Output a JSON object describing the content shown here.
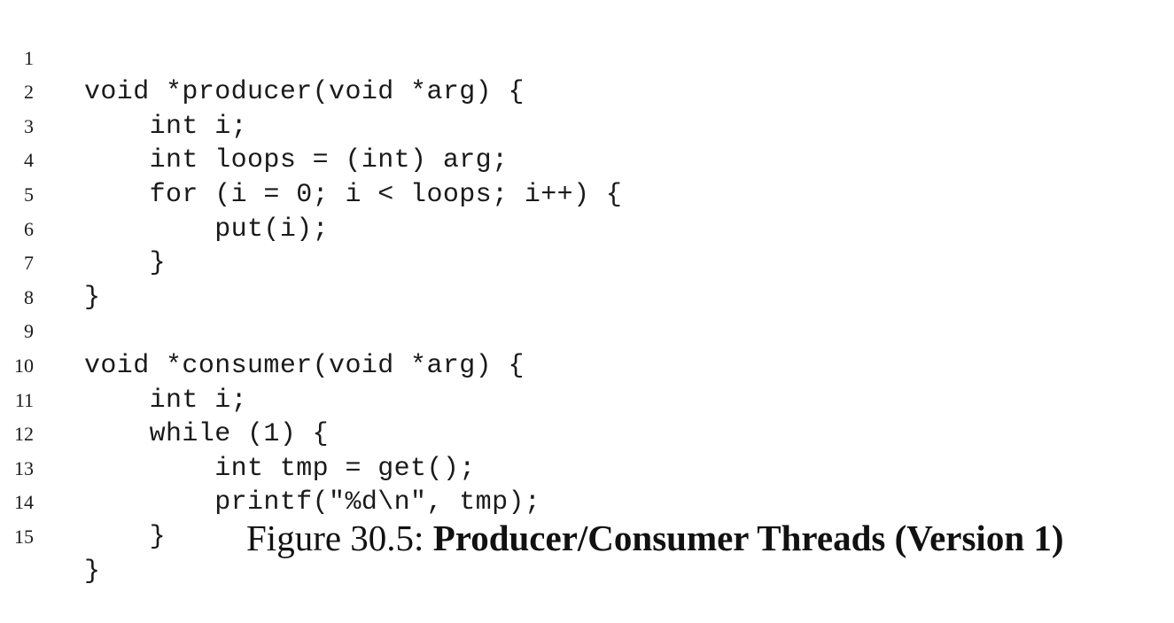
{
  "code": {
    "lines": [
      {
        "number": "1",
        "text": "void *producer(void *arg) {"
      },
      {
        "number": "2",
        "text": "    int i;"
      },
      {
        "number": "3",
        "text": "    int loops = (int) arg;"
      },
      {
        "number": "4",
        "text": "    for (i = 0; i < loops; i++) {"
      },
      {
        "number": "5",
        "text": "        put(i);"
      },
      {
        "number": "6",
        "text": "    }"
      },
      {
        "number": "7",
        "text": "}"
      },
      {
        "number": "8",
        "text": ""
      },
      {
        "number": "9",
        "text": "void *consumer(void *arg) {"
      },
      {
        "number": "10",
        "text": "    int i;"
      },
      {
        "number": "11",
        "text": "    while (1) {"
      },
      {
        "number": "12",
        "text": "        int tmp = get();"
      },
      {
        "number": "13",
        "text": "        printf(\"%d\\n\", tmp);"
      },
      {
        "number": "14",
        "text": "    }"
      },
      {
        "number": "15",
        "text": "}"
      }
    ]
  },
  "caption": {
    "label": "Figure 30.5: ",
    "title": "Producer/Consumer Threads (Version 1)"
  }
}
